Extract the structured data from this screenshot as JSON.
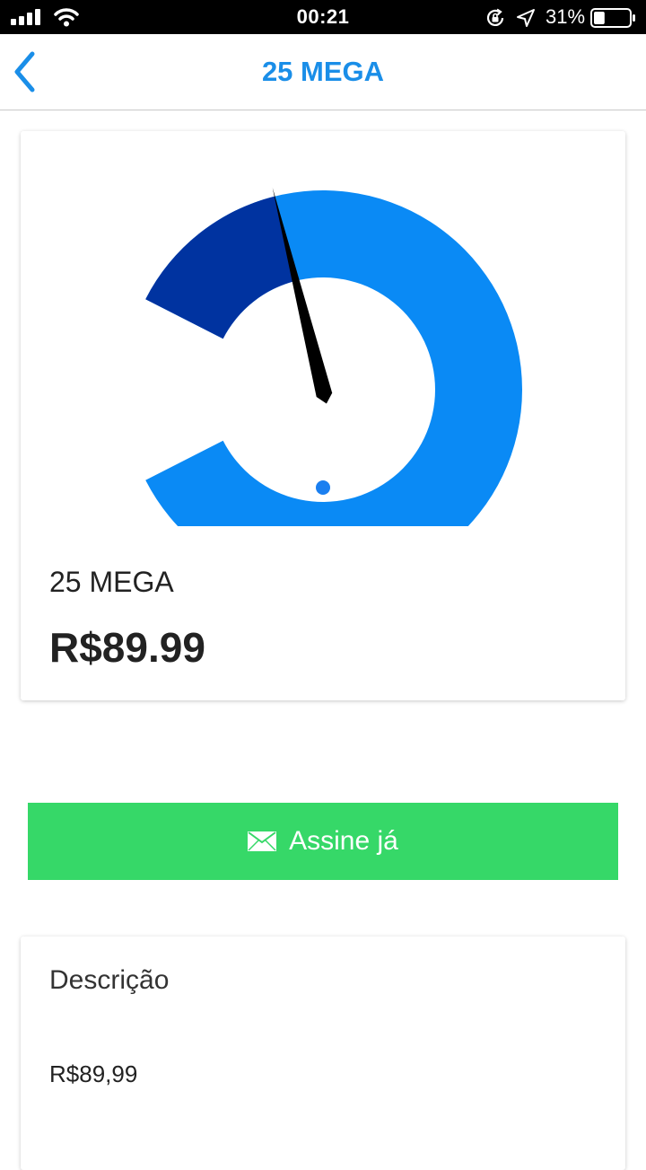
{
  "status_bar": {
    "time": "00:21",
    "battery_percent": "31%",
    "battery_level": 0.31,
    "signal_icon": "signal-bars-icon",
    "wifi_icon": "wifi-icon",
    "orientation_lock_icon": "orientation-lock-icon",
    "location_icon": "location-arrow-icon"
  },
  "nav": {
    "title": "25 MEGA",
    "back_icon": "chevron-left-icon",
    "accent_color": "#1a8ee8"
  },
  "plan": {
    "name": "25 MEGA",
    "price": "R$89.99",
    "gauge": {
      "level": 0.16,
      "filled_color": "#0033a0",
      "track_color": "#0a8af5",
      "needle_color": "#000000",
      "dot_color": "#1a7ff0"
    }
  },
  "subscribe": {
    "label": "Assine já",
    "icon": "mail-icon",
    "color": "#36d868"
  },
  "description": {
    "title": "Descrição",
    "text": "R$89,99"
  }
}
